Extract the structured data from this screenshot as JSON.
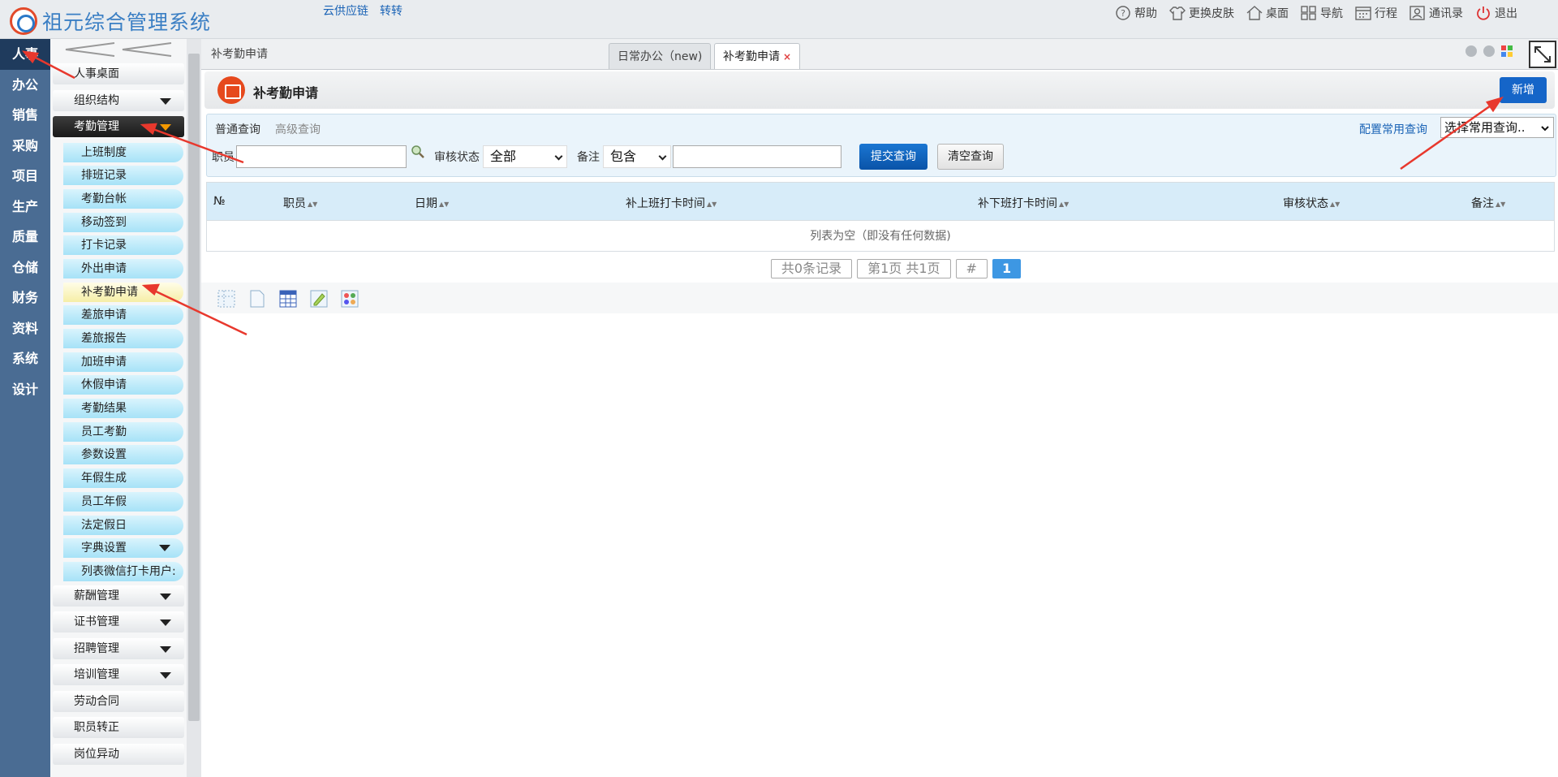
{
  "app": {
    "title": "祖元综合管理系统",
    "top_links": [
      "云供应链",
      "转转"
    ],
    "tools": [
      {
        "label": "帮助",
        "icon": "help-icon"
      },
      {
        "label": "更换皮肤",
        "icon": "shirt-icon"
      },
      {
        "label": "桌面",
        "icon": "home-icon"
      },
      {
        "label": "导航",
        "icon": "grid-icon"
      },
      {
        "label": "行程",
        "icon": "calendar-icon"
      },
      {
        "label": "通讯录",
        "icon": "contacts-icon"
      },
      {
        "label": "退出",
        "icon": "power-icon"
      }
    ]
  },
  "categories": [
    "人事",
    "办公",
    "销售",
    "采购",
    "项目",
    "生产",
    "质量",
    "仓储",
    "财务",
    "资料",
    "系统",
    "设计"
  ],
  "active_category": "人事",
  "sidebar": {
    "collapse_icon": "double-chevron-left-icon",
    "top_items": [
      "人事桌面",
      "组织结构"
    ],
    "open_group": "考勤管理",
    "sub_items": [
      "上班制度",
      "排班记录",
      "考勤台帐",
      "移动签到",
      "打卡记录",
      "外出申请",
      "补考勤申请",
      "差旅申请",
      "差旅报告",
      "加班申请",
      "休假申请",
      "考勤结果",
      "员工考勤",
      "参数设置",
      "年假生成",
      "员工年假",
      "法定假日",
      "字典设置",
      "列表微信打卡用户:"
    ],
    "selected_sub": "补考勤申请",
    "bottom_items": [
      "薪酬管理",
      "证书管理",
      "招聘管理",
      "培训管理",
      "劳动合同",
      "职员转正",
      "岗位异动"
    ]
  },
  "tabs": {
    "breadcrumb": "补考勤申请",
    "items": [
      {
        "label": "日常办公（new)"
      },
      {
        "label": "补考勤申请",
        "close": "×"
      }
    ]
  },
  "page": {
    "title": "补考勤申请",
    "new_button": "新增"
  },
  "query": {
    "tab_normal": "普通查询",
    "tab_advanced": "高级查询",
    "config_link": "配置常用查询",
    "saved_query": "选择常用查询..",
    "staff_label": "职员",
    "status_label": "审核状态",
    "status_value": "全部",
    "remark_label": "备注",
    "remark_op": "包含",
    "submit": "提交查询",
    "clear": "清空查询"
  },
  "grid": {
    "columns": [
      "№",
      "职员",
      "日期",
      "补上班打卡时间",
      "补下班打卡时间",
      "审核状态",
      "备注"
    ],
    "empty_text": "列表为空（即没有任何数据)"
  },
  "pager": {
    "total": "共0条记录",
    "page_info": "第1页 共1页",
    "jump": "#",
    "current": "1"
  },
  "toolbar_icons": [
    "grid-select-icon",
    "document-icon",
    "table-icon",
    "edit-icon",
    "palette-icon"
  ],
  "colors": {
    "category_bar": "#4a6c93",
    "primary_button": "#1565c8",
    "annotation": "#e8382d"
  }
}
